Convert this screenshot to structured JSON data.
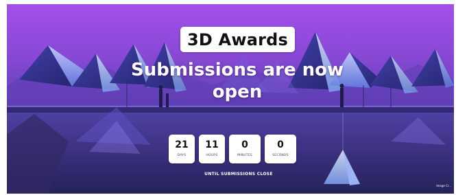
{
  "banner": {
    "title": "3D Awards",
    "headline": "Submissions are now open",
    "countdown": [
      {
        "value": "21",
        "label": "DAYS"
      },
      {
        "value": "11",
        "label": "HOURS"
      },
      {
        "value": "0",
        "label": "MINUTES"
      },
      {
        "value": "0",
        "label": "SECONDS"
      }
    ],
    "until_text": "UNTIL SUBMISSIONS CLOSE",
    "credit": "Image Cr..."
  },
  "colors": {
    "sky_top": "#a24be9",
    "sky_bottom": "#2a246a",
    "badge_bg": "#ffffff",
    "headline_text": "#ffffff"
  }
}
